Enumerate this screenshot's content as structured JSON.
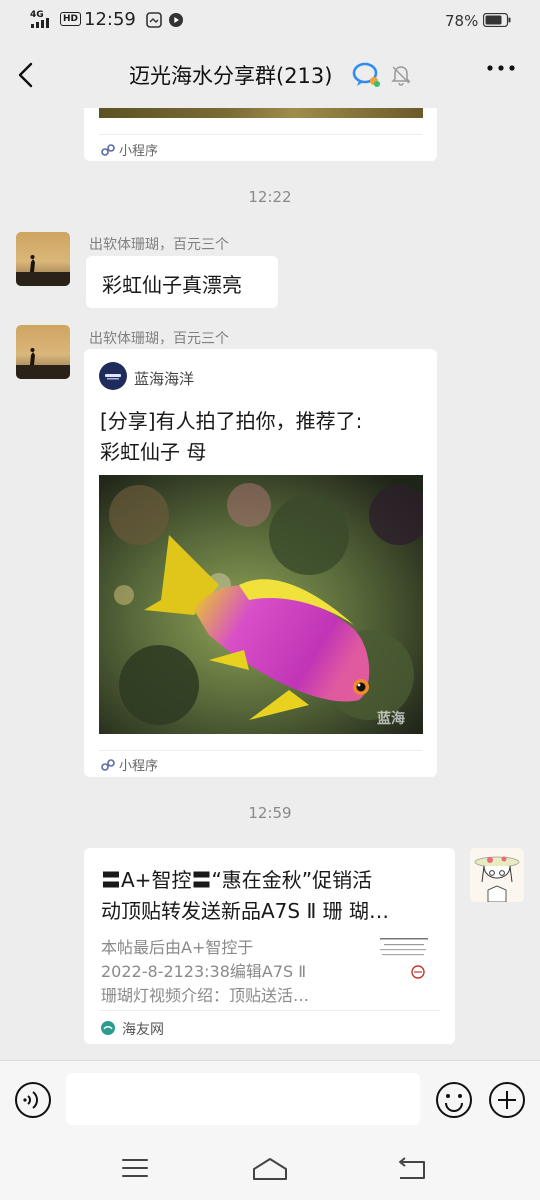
{
  "status_bar": {
    "network": "4G",
    "hd": "HD",
    "time": "12:59",
    "battery_pct": "78%"
  },
  "nav": {
    "title": "迈光海水分享群(213)"
  },
  "messages": {
    "top_card": {
      "mini_program_label": "小程序"
    },
    "timestamp_1": "12:22",
    "msg1": {
      "sender": "出软体珊瑚，百元三个",
      "text": "彩虹仙子真漂亮"
    },
    "msg2": {
      "sender": "出软体珊瑚，百元三个",
      "app_name": "蓝海海洋",
      "title_line1": "[分享]有人拍了拍你，推荐了:",
      "title_line2": "彩虹仙子 母",
      "image_watermark": "蓝海",
      "mini_program_label": "小程序"
    },
    "timestamp_2": "12:59",
    "msg3": {
      "title_line1": "〓A+智控〓“惠在金秋”促销活",
      "title_line2": "动顶贴转发送新品A7S Ⅱ 珊 瑚…",
      "desc_line1": "本帖最后由A+智控于",
      "desc_line2": "2022-8-2123:38编辑A7S Ⅱ",
      "desc_line3": "珊瑚灯视频介绍：顶贴送活…",
      "source": "海友网"
    }
  },
  "input": {
    "placeholder": ""
  },
  "colors": {
    "background": "#ededed",
    "bubble": "#ffffff",
    "meta_text": "#8a8a8a",
    "accent_blue": "#2f8cf0"
  }
}
